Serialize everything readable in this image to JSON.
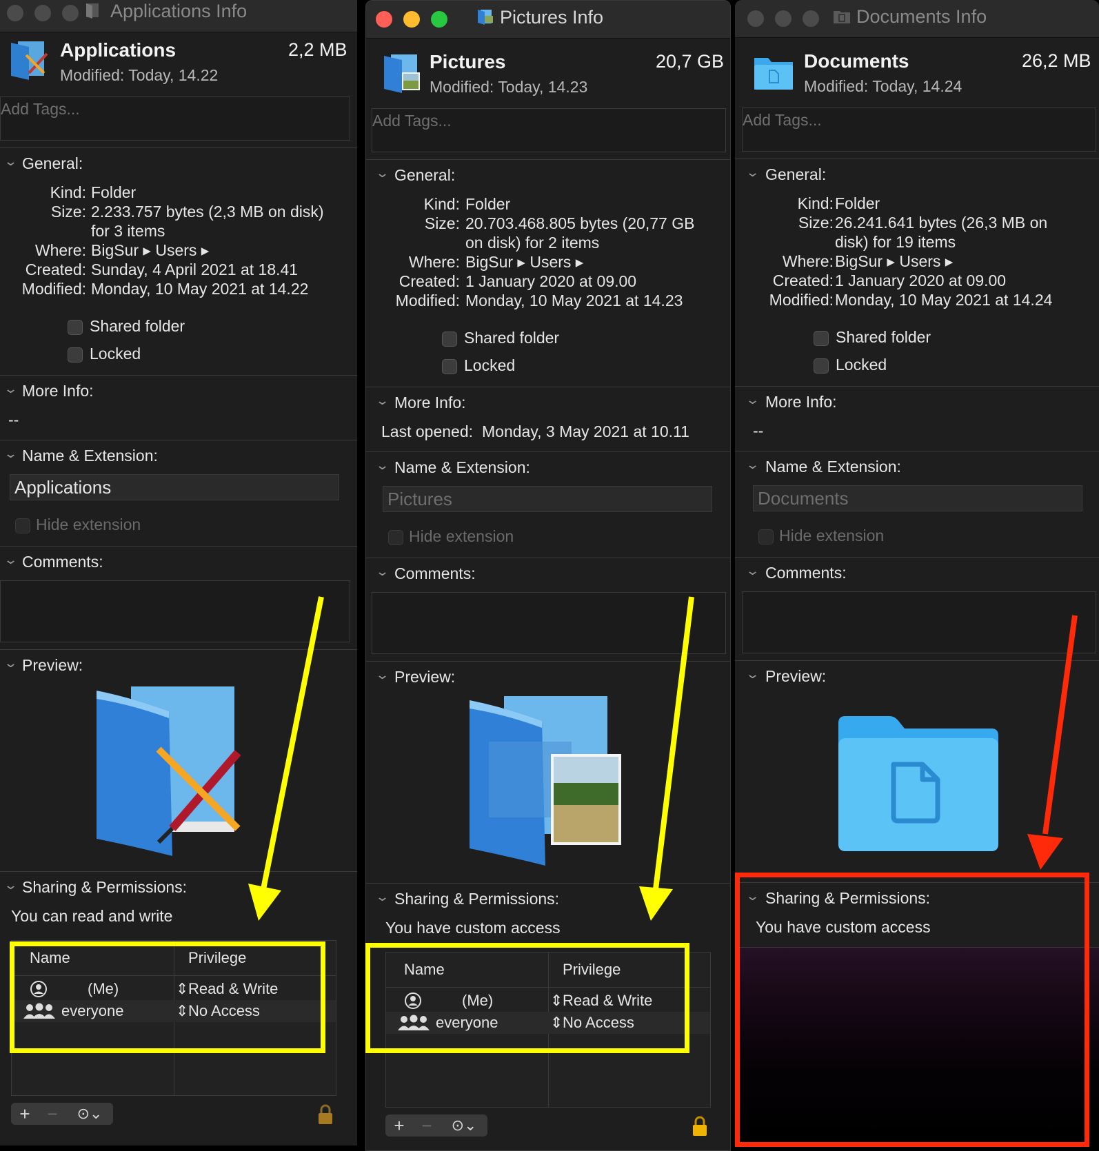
{
  "colors": {
    "highlight_yellow": "#ffff00",
    "highlight_red": "#ff2a0a",
    "window_bg": "#1e1e1e"
  },
  "windows": [
    {
      "title": "Applications Info",
      "name": "Applications",
      "size": "2,2 MB",
      "modified": "Modified: Today, 14.22",
      "tags_placeholder": "Add Tags...",
      "general_title": "General:",
      "kind_label": "Kind:",
      "kind": "Folder",
      "size_label": "Size:",
      "size_detail_1": "2.233.757 bytes (2,3 MB on disk)",
      "size_detail_2": "for 3 items",
      "where_label": "Where:",
      "where": "BigSur ▸ Users ▸",
      "created_label": "Created:",
      "created": "Sunday, 4 April 2021 at 18.41",
      "modified_label": "Modified:",
      "modified_full": "Monday, 10 May 2021 at 14.22",
      "shared_folder": "Shared folder",
      "locked": "Locked",
      "more_info_title": "More Info:",
      "more_info": "--",
      "name_ext_title": "Name & Extension:",
      "name_field": "Applications",
      "hide_extension": "Hide extension",
      "comments_title": "Comments:",
      "preview_title": "Preview:",
      "sharing_title": "Sharing & Permissions:",
      "access": "You can read and write",
      "col_name": "Name",
      "col_privilege": "Privilege",
      "rows": [
        {
          "name": "(Me)",
          "privilege": "Read & Write"
        },
        {
          "name": "everyone",
          "privilege": "No Access"
        }
      ],
      "btn_add": "+",
      "btn_remove": "−",
      "btn_action": "⊙⌄"
    },
    {
      "title": "Pictures Info",
      "name": "Pictures",
      "size": "20,7 GB",
      "modified": "Modified: Today, 14.23",
      "tags_placeholder": "Add Tags...",
      "general_title": "General:",
      "kind_label": "Kind:",
      "kind": "Folder",
      "size_label": "Size:",
      "size_detail_1": "20.703.468.805 bytes (20,77 GB",
      "size_detail_2": "on disk) for 2 items",
      "where_label": "Where:",
      "where": "BigSur ▸ Users ▸",
      "created_label": "Created:",
      "created": "1 January 2020 at 09.00",
      "modified_label": "Modified:",
      "modified_full": "Monday, 10 May 2021 at 14.23",
      "shared_folder": "Shared folder",
      "locked": "Locked",
      "more_info_title": "More Info:",
      "last_opened_label": "Last opened:",
      "last_opened": "Monday, 3 May 2021 at 10.11",
      "name_ext_title": "Name & Extension:",
      "name_field": "Pictures",
      "hide_extension": "Hide extension",
      "comments_title": "Comments:",
      "preview_title": "Preview:",
      "sharing_title": "Sharing & Permissions:",
      "access": "You have custom access",
      "col_name": "Name",
      "col_privilege": "Privilege",
      "rows": [
        {
          "name": "(Me)",
          "privilege": "Read & Write"
        },
        {
          "name": "everyone",
          "privilege": "No Access"
        }
      ],
      "btn_add": "+",
      "btn_remove": "−",
      "btn_action": "⊙⌄"
    },
    {
      "title": "Documents Info",
      "name": "Documents",
      "size": "26,2 MB",
      "modified": "Modified: Today, 14.24",
      "tags_placeholder": "Add Tags...",
      "general_title": "General:",
      "kind_label": "Kind:",
      "kind": "Folder",
      "size_label": "Size:",
      "size_detail_1": "26.241.641 bytes (26,3 MB on",
      "size_detail_2": "disk) for 19 items",
      "where_label": "Where:",
      "where": "BigSur ▸ Users ▸",
      "created_label": "Created:",
      "created": "1 January 2020 at 09.00",
      "modified_label": "Modified:",
      "modified_full": "Monday, 10 May 2021 at 14.24",
      "shared_folder": "Shared folder",
      "locked": "Locked",
      "more_info_title": "More Info:",
      "more_info": "--",
      "name_ext_title": "Name & Extension:",
      "name_field": "Documents",
      "hide_extension": "Hide extension",
      "comments_title": "Comments:",
      "preview_title": "Preview:",
      "sharing_title": "Sharing & Permissions:",
      "access": "You have custom access"
    }
  ],
  "icons": {
    "chevron": "chevron-down-icon",
    "user": "user-icon",
    "group": "group-icon",
    "stepper": "stepper-icon",
    "lock": "lock-icon"
  },
  "glyphs": {
    "chevron": "⌄",
    "stepper": "⇕"
  }
}
